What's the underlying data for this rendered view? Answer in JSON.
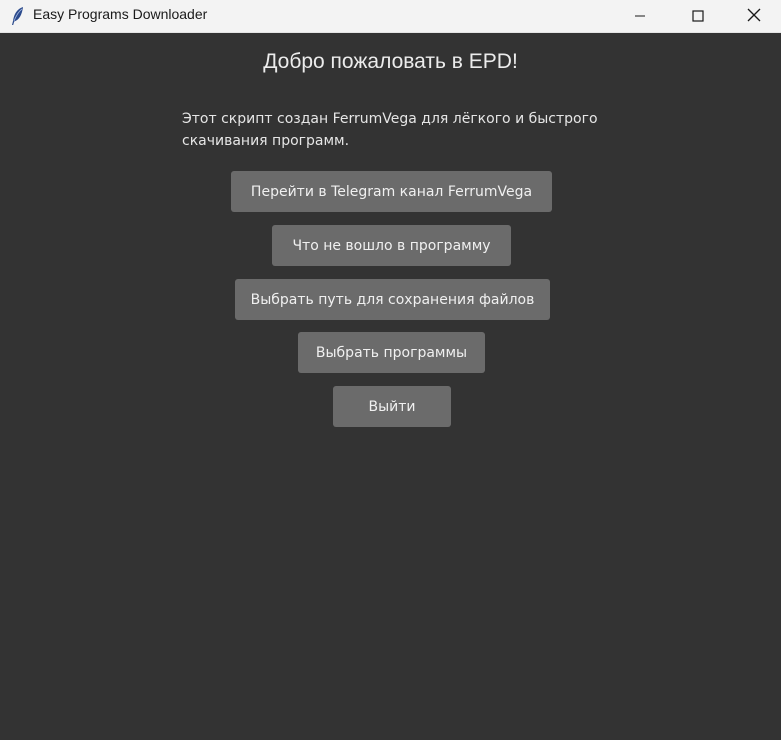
{
  "window": {
    "title": "Easy Programs Downloader",
    "icon": "feather-icon",
    "controls": [
      "minimize-icon",
      "maximize-icon",
      "close-icon"
    ]
  },
  "main": {
    "heading": "Добро пожаловать в EPD!",
    "description": "Этот скрипт создан FerrumVega для лёгкого и быстрого скачивания программ.",
    "buttons": [
      {
        "label": "Перейти в Telegram канал FerrumVega"
      },
      {
        "label": "Что не вошло в программу"
      },
      {
        "label": "Выбрать путь для сохранения файлов"
      },
      {
        "label": "Выбрать программы"
      },
      {
        "label": "Выйти"
      }
    ]
  },
  "colors": {
    "background": "#333333",
    "button": "#6b6b6b",
    "titlebar": "#f3f3f3",
    "text": "#ececec"
  }
}
